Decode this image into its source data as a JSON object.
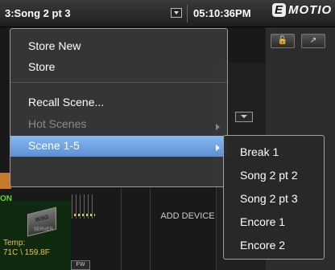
{
  "topbar": {
    "scene_name": "3:Song 2 pt 3",
    "time": "05:10:36PM",
    "brand": "EMOTION",
    "brand_initial": "E",
    "brand_rest": "MOTIO"
  },
  "menu": {
    "items": [
      {
        "label": "Store New",
        "enabled": true
      },
      {
        "label": "Store",
        "enabled": true
      },
      {
        "label": "Recall Scene...",
        "enabled": true
      },
      {
        "label": "Hot Scenes",
        "enabled": false,
        "has_submenu": true
      },
      {
        "label": "Scene 1-5",
        "enabled": true,
        "has_submenu": true,
        "selected": true
      }
    ]
  },
  "submenu": {
    "items": [
      "Break 1",
      "Song 2 pt 2",
      "Song 2 pt 3",
      "Encore 1",
      "Encore 2"
    ]
  },
  "background": {
    "on_label": "ON",
    "server_name": "WSG",
    "server_caption": "SERVER",
    "temp_label": "Temp:",
    "temp_value": "71C \\ 159.8F",
    "fw_label": "FW",
    "add_device": "ADD DEVICE"
  },
  "colors": {
    "selection": "#6fa0e0",
    "on_indicator": "#62d62a",
    "temp_text": "#e6c34a"
  },
  "icons": [
    "dropdown-arrow-icon",
    "lock-icon",
    "expand-icon",
    "submenu-arrow-icon"
  ]
}
